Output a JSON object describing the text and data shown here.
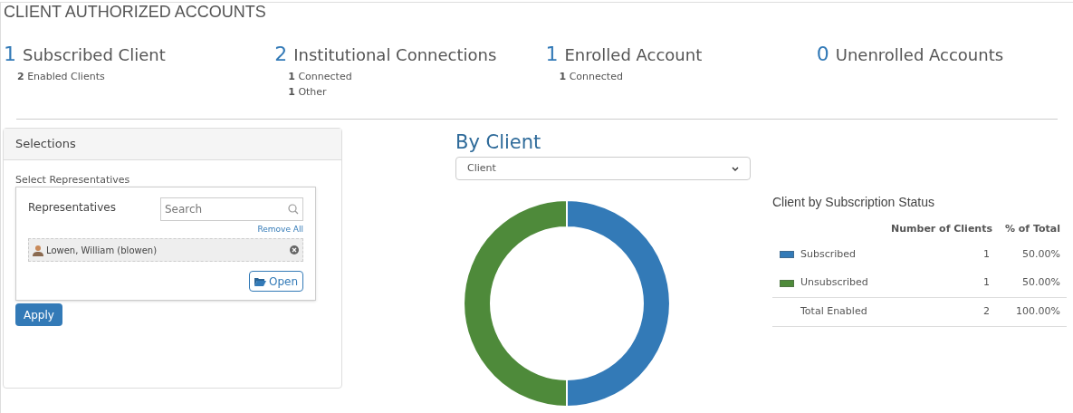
{
  "title": "CLIENT AUTHORIZED ACCOUNTS",
  "stats": [
    {
      "value": "1",
      "label": "Subscribed Client",
      "details": [
        "**2** Enabled Clients"
      ]
    },
    {
      "value": "2",
      "label": "Institutional Connections",
      "details": [
        "**1** Connected",
        "**1** Other"
      ]
    },
    {
      "value": "1",
      "label": "Enrolled Account",
      "details": [
        "**1** Connected"
      ]
    },
    {
      "value": "0",
      "label": "Unenrolled Accounts"
    }
  ],
  "selections": {
    "title": "Selections",
    "section_label": "Select Representatives",
    "list_label": "Representatives",
    "search": {
      "placeholder": "Search"
    },
    "remove_all": "Remove All",
    "items": [
      {
        "name": "Lowen, William (blowen)"
      }
    ],
    "open_button": "Open",
    "apply_button": "Apply"
  },
  "chart_section": {
    "title": "By Client",
    "dropdown": {
      "value": "Client"
    }
  },
  "table": {
    "title": "Client by Subscription Status",
    "columns": [
      "Number of Clients",
      "% of Total"
    ],
    "rows": [
      {
        "label": "Subscribed",
        "color": "#337ab7",
        "count": "1",
        "percent": "50.00%"
      },
      {
        "label": "Unsubscribed",
        "color": "#4e8a3a",
        "count": "1",
        "percent": "50.00%"
      }
    ],
    "total": {
      "label": "Total Enabled",
      "count": "2",
      "percent": "100.00%"
    }
  }
}
